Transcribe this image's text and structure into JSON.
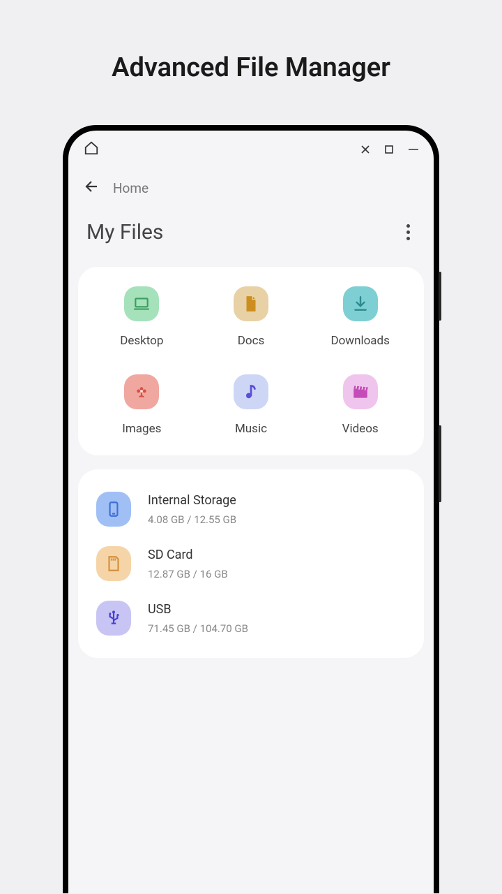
{
  "page_title": "Advanced File Manager",
  "breadcrumb": "Home",
  "section_title": "My Files",
  "categories": [
    {
      "label": "Desktop",
      "icon": "laptop",
      "bg": "bg-green",
      "color": "#3d9c5f"
    },
    {
      "label": "Docs",
      "icon": "document",
      "bg": "bg-tan",
      "color": "#cc8f1f"
    },
    {
      "label": "Downloads",
      "icon": "download",
      "bg": "bg-teal",
      "color": "#2a8a8f"
    },
    {
      "label": "Images",
      "icon": "flower",
      "bg": "bg-coral",
      "color": "#d94e42"
    },
    {
      "label": "Music",
      "icon": "note",
      "bg": "bg-lavender",
      "color": "#5a4fd6"
    },
    {
      "label": "Videos",
      "icon": "clapper",
      "bg": "bg-pink",
      "color": "#c44bb8"
    }
  ],
  "storages": [
    {
      "name": "Internal Storage",
      "size": "4.08 GB / 12.55 GB",
      "icon": "phone",
      "bg": "bg-blue",
      "color": "#3e6fd6"
    },
    {
      "name": "SD Card",
      "size": "12.87 GB / 16 GB",
      "icon": "sdcard",
      "bg": "bg-peach",
      "color": "#d68f3e"
    },
    {
      "name": "USB",
      "size": "71.45 GB / 104.70 GB",
      "icon": "usb",
      "bg": "bg-lilac",
      "color": "#4a3fd1"
    }
  ]
}
